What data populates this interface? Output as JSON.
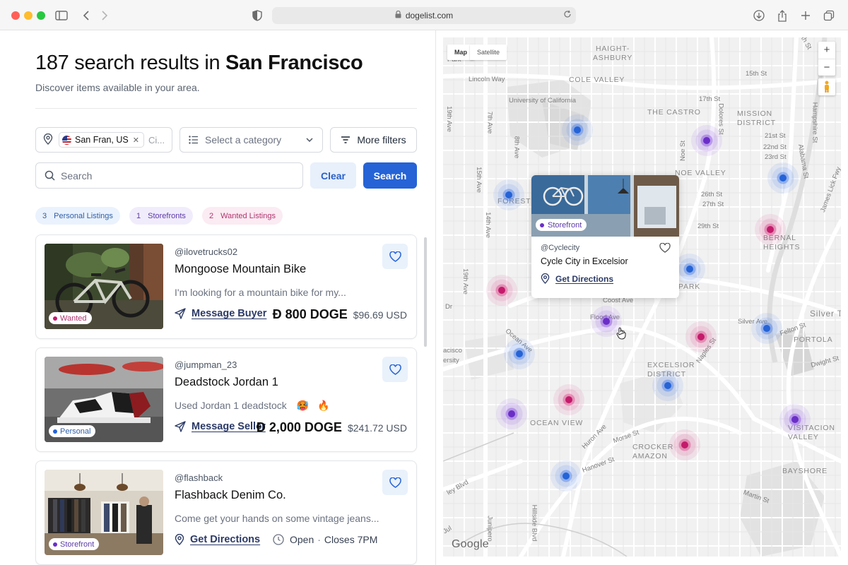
{
  "browser": {
    "url": "dogelist.com"
  },
  "header": {
    "title_prefix": "187 search results in ",
    "title_location": "San Francisco",
    "subtitle": "Discover items available in your area."
  },
  "filters": {
    "location_chip": "San Fran, US",
    "location_more": "Ci...",
    "category_placeholder": "Select a category",
    "more_filters_label": "More filters",
    "search_placeholder": "Search",
    "clear_label": "Clear",
    "search_label": "Search"
  },
  "tags": [
    {
      "count": "3",
      "label": "Personal Listings"
    },
    {
      "count": "1",
      "label": "Storefronts"
    },
    {
      "count": "2",
      "label": "Wanted Listings"
    }
  ],
  "listings": [
    {
      "handle": "@ilovetrucks02",
      "title": "Mongoose Mountain Bike",
      "description": "I'm looking for a mountain bike for my...",
      "badge": "Wanted",
      "action": "Message Buyer",
      "price_doge": "Ð 800 DOGE",
      "price_usd": "$96.69 USD"
    },
    {
      "handle": "@jumpman_23",
      "title": "Deadstock Jordan 1",
      "description": "Used Jordan 1 deadstock",
      "emoji": "🥵 🔥",
      "badge": "Personal",
      "action": "Message Seller",
      "price_doge": "Ð 2,000 DOGE",
      "price_usd": "$241.72 USD"
    },
    {
      "handle": "@flashback",
      "title": "Flashback Denim Co.",
      "description": "Come get your hands on some vintage jeans...",
      "badge": "Storefront",
      "action": "Get Directions",
      "status": "Open",
      "closes": "Closes 7PM"
    }
  ],
  "map": {
    "tabs": [
      "Map",
      "Satellite"
    ],
    "attribution": "Google",
    "zoom_in": "+",
    "zoom_out": "−",
    "neighborhoods": [
      "HAIGHT-ASHBURY",
      "COLE VALLEY",
      "THE CASTRO",
      "MISSION DISTRICT",
      "NOE VALLEY",
      "BERNAL HEIGHTS",
      "FOREST",
      "PARK",
      "EXCELSIOR DISTRICT",
      "PORTOLA",
      "OCEAN VIEW",
      "CROCKER AMAZON",
      "VISITACION VALLEY",
      "BAYSHORE",
      "Silver T"
    ],
    "streets": [
      "Lincoln Way",
      "University of California",
      "15th St",
      "17th St",
      "19th Ave",
      "Park",
      "21st St",
      "22nd St",
      "23rd St",
      "26th St",
      "27th St",
      "29th St",
      "15th Ave",
      "14th Ave",
      "19th Ave",
      "8th Ave",
      "7th Ave",
      "Noe St",
      "Dolores St",
      "Hampshire St",
      "Alabama St",
      "James Lick Fwy",
      "Ocean Ave",
      "Flood Ave",
      "Coost Ave",
      "Naples St",
      "Felton St",
      "Silver Ave",
      "Dwight St",
      "Huron Ave",
      "Morse St",
      "Hanover St",
      "Martin St",
      "Hillside Blvd",
      "Junipero",
      "ley Blvd",
      "Dr",
      "acisco",
      "ersity",
      "uth St",
      "Jul"
    ],
    "markers": [
      {
        "color": "blue"
      },
      {
        "color": "purple"
      },
      {
        "color": "blue"
      },
      {
        "color": "blue"
      },
      {
        "color": "pink"
      },
      {
        "color": "blue"
      },
      {
        "color": "pink"
      },
      {
        "color": "purple"
      },
      {
        "color": "blue"
      },
      {
        "color": "pink"
      },
      {
        "color": "blue"
      },
      {
        "color": "blue"
      },
      {
        "color": "purple"
      },
      {
        "color": "pink"
      },
      {
        "color": "purple"
      },
      {
        "color": "pink"
      },
      {
        "color": "blue"
      }
    ],
    "popup": {
      "badge": "Storefront",
      "handle": "@Cyclecity",
      "title": "Cycle City in Excelsior",
      "action": "Get Directions"
    }
  },
  "colors": {
    "primary": "#2563d6",
    "personal": "#2563d6",
    "storefront": "#6a2fc7",
    "wanted": "#c41b6b"
  }
}
